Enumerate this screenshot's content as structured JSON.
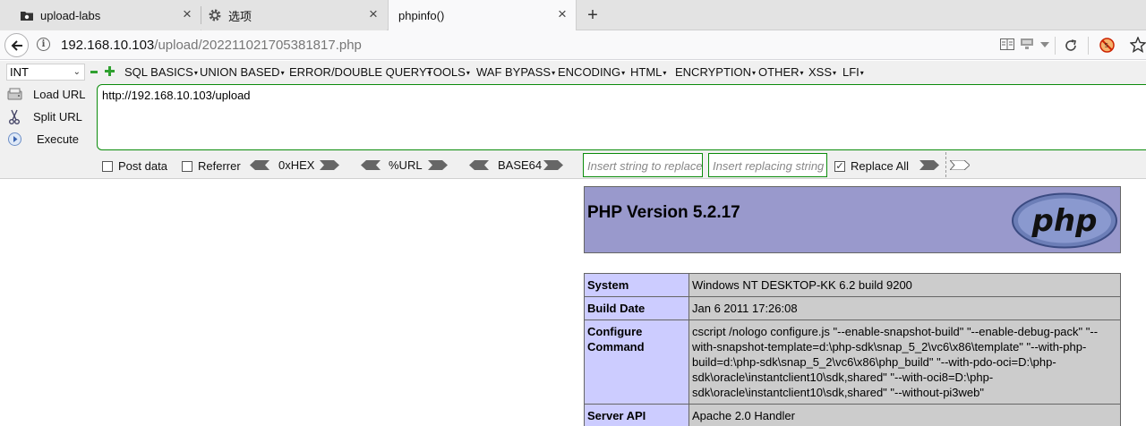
{
  "tabs": [
    {
      "title": "upload-labs",
      "icon": "folder-game-icon"
    },
    {
      "title": "选项",
      "icon": "gear-icon"
    },
    {
      "title": "phpinfo()",
      "icon": "none",
      "active": true
    }
  ],
  "nav": {
    "url_host": "192.168.10.103",
    "url_path": "/upload/202211021705381817.php"
  },
  "hackbar": {
    "select_value": "INT",
    "menus": [
      "SQL BASICS",
      "UNION BASED",
      "ERROR/DOUBLE QUERY",
      "TOOLS",
      "WAF BYPASS",
      "ENCODING",
      "HTML",
      "ENCRYPTION",
      "OTHER",
      "XSS",
      "LFI"
    ],
    "buttons": {
      "load": "Load URL",
      "split": "Split URL",
      "execute": "Execute"
    },
    "url_value": "http://192.168.10.103/upload",
    "post_data": "Post data",
    "referrer": "Referrer",
    "enc": {
      "hex": "0xHEX",
      "url": "%URL",
      "base64": "BASE64"
    },
    "replace_placeholder": "Insert string to replace",
    "replacing_placeholder": "Insert replacing string",
    "replace_all": "Replace All",
    "replace_all_checked": true
  },
  "phpinfo": {
    "version": "PHP Version 5.2.17",
    "rows": [
      {
        "key": "System",
        "value": "Windows NT DESKTOP-KK 6.2 build 9200"
      },
      {
        "key": "Build Date",
        "value": "Jan 6 2011 17:26:08"
      },
      {
        "key": "Configure Command",
        "value": "cscript /nologo configure.js \"--enable-snapshot-build\" \"--enable-debug-pack\" \"--with-snapshot-template=d:\\php-sdk\\snap_5_2\\vc6\\x86\\template\" \"--with-php-build=d:\\php-sdk\\snap_5_2\\vc6\\x86\\php_build\" \"--with-pdo-oci=D:\\php-sdk\\oracle\\instantclient10\\sdk,shared\" \"--with-oci8=D:\\php-sdk\\oracle\\instantclient10\\sdk,shared\" \"--without-pi3web\""
      },
      {
        "key": "Server API",
        "value": "Apache 2.0 Handler"
      }
    ]
  },
  "colors": {
    "php_header": "#9999cc",
    "php_key": "#ccccff",
    "php_value": "#cccccc",
    "hackbar_border": "#0c8c0c"
  }
}
